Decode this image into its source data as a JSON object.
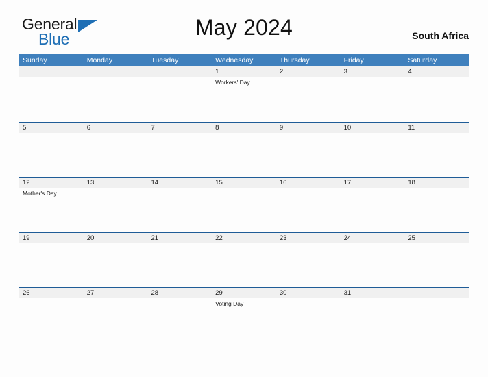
{
  "logo": {
    "word_one": "General",
    "word_two": "Blue",
    "triangle_icon": "triangle-icon",
    "brand_blue": "#1f6fb5"
  },
  "header": {
    "title": "May 2024",
    "country": "South Africa"
  },
  "colors": {
    "header_blue": "#3f80bd",
    "rule_blue": "#1f5c97",
    "date_band_gray": "#f0f0f0",
    "page_background": "#fdfdfd",
    "text": "#1a1a1a"
  },
  "calendar": {
    "weekdays": [
      "Sunday",
      "Monday",
      "Tuesday",
      "Wednesday",
      "Thursday",
      "Friday",
      "Saturday"
    ],
    "weeks": [
      {
        "days": [
          {
            "date": "",
            "event": ""
          },
          {
            "date": "",
            "event": ""
          },
          {
            "date": "",
            "event": ""
          },
          {
            "date": "1",
            "event": "Workers' Day"
          },
          {
            "date": "2",
            "event": ""
          },
          {
            "date": "3",
            "event": ""
          },
          {
            "date": "4",
            "event": ""
          }
        ]
      },
      {
        "days": [
          {
            "date": "5",
            "event": ""
          },
          {
            "date": "6",
            "event": ""
          },
          {
            "date": "7",
            "event": ""
          },
          {
            "date": "8",
            "event": ""
          },
          {
            "date": "9",
            "event": ""
          },
          {
            "date": "10",
            "event": ""
          },
          {
            "date": "11",
            "event": ""
          }
        ]
      },
      {
        "days": [
          {
            "date": "12",
            "event": "Mother's Day"
          },
          {
            "date": "13",
            "event": ""
          },
          {
            "date": "14",
            "event": ""
          },
          {
            "date": "15",
            "event": ""
          },
          {
            "date": "16",
            "event": ""
          },
          {
            "date": "17",
            "event": ""
          },
          {
            "date": "18",
            "event": ""
          }
        ]
      },
      {
        "days": [
          {
            "date": "19",
            "event": ""
          },
          {
            "date": "20",
            "event": ""
          },
          {
            "date": "21",
            "event": ""
          },
          {
            "date": "22",
            "event": ""
          },
          {
            "date": "23",
            "event": ""
          },
          {
            "date": "24",
            "event": ""
          },
          {
            "date": "25",
            "event": ""
          }
        ]
      },
      {
        "days": [
          {
            "date": "26",
            "event": ""
          },
          {
            "date": "27",
            "event": ""
          },
          {
            "date": "28",
            "event": ""
          },
          {
            "date": "29",
            "event": "Voting Day"
          },
          {
            "date": "30",
            "event": ""
          },
          {
            "date": "31",
            "event": ""
          },
          {
            "date": "",
            "event": ""
          }
        ]
      }
    ]
  }
}
